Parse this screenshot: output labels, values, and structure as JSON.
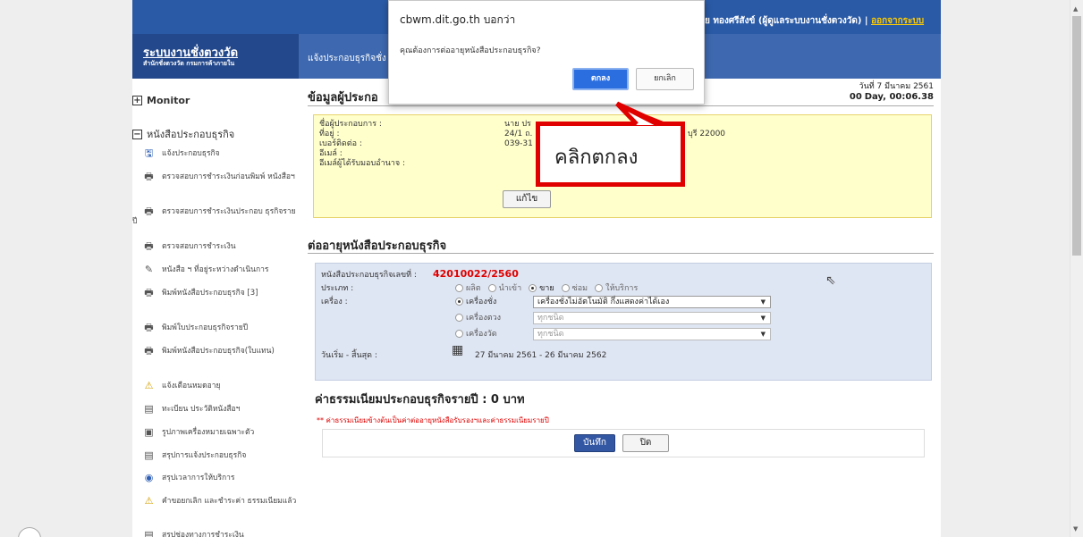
{
  "header": {
    "brand_title": "ระบบงานชั่งตวงวัด",
    "brand_sub": "สำนักชั่งตวงวัด กรมการค้าภายใน",
    "breadcrumb": "แจ้งประกอบธุรกิจชั่ง",
    "user": "ย ทองศรีสังข์ (ผู้ดูแลระบบงานชั่งตวงวัด) | ",
    "logout": "ออกจากระบบ"
  },
  "sidebar": {
    "monitor": "Monitor",
    "section": "หนังสือประกอบธุรกิจ",
    "items": [
      {
        "icon": "save-icon",
        "glyph": "🖫",
        "label": "แจ้งประกอบธุรกิจ"
      },
      {
        "icon": "printer-icon",
        "glyph": "🖶",
        "label": "ตรวจสอบการชำระเงินก่อนพิมพ์ หนังสือฯ"
      },
      {
        "icon": "printer-icon",
        "glyph": "🖶",
        "label": "ตรวจสอบการชำระเงินประกอบ ธุรกิจรายปี"
      },
      {
        "icon": "printer-icon",
        "glyph": "🖶",
        "label": "ตรวจสอบการชำระเงิน"
      },
      {
        "icon": "edit-icon",
        "glyph": "✎",
        "label": "หนังสือ ฯ ที่อยู่ระหว่างดำเนินการ"
      },
      {
        "icon": "printer-icon",
        "glyph": "🖶",
        "label": "พิมพ์หนังสือประกอบธุรกิจ [3]"
      },
      {
        "icon": "printer-icon",
        "glyph": "🖶",
        "label": "พิมพ์ใบประกอบธุรกิจรายปี"
      },
      {
        "icon": "printer-icon",
        "glyph": "🖶",
        "label": "พิมพ์หนังสือประกอบธุรกิจ(ใบแทน)"
      },
      {
        "icon": "warning-icon",
        "glyph": "⚠",
        "label": "แจ้งเตือนหมดอายุ"
      },
      {
        "icon": "register-icon",
        "glyph": "▤",
        "label": "ทะเบียน ประวัติหนังสือฯ"
      },
      {
        "icon": "image-icon",
        "glyph": "▣",
        "label": "รูปภาพเครื่องหมายเฉพาะตัว"
      },
      {
        "icon": "summary-icon",
        "glyph": "▤",
        "label": "สรุปการแจ้งประกอบธุรกิจ"
      },
      {
        "icon": "clock-icon",
        "glyph": "◉",
        "label": "สรุปเวลาการให้บริการ"
      },
      {
        "icon": "warning-icon",
        "glyph": "⚠",
        "label": "คำขอยกเลิก และชำระค่า ธรรมเนียมแล้ว"
      },
      {
        "icon": "summary-icon",
        "glyph": "▤",
        "label": "สรุปช่องทางการชำระเงิน"
      }
    ]
  },
  "main": {
    "section1_title": "ข้อมูลผู้ประกอ",
    "date_line": "วันที่ 7 มีนาคม 2561",
    "timer_strong": "00",
    "timer_rest": "Day, 00:06.38",
    "labels": [
      "ชื่อผู้ประกอบการ :",
      "ที่อยู่ :",
      "เบอร์ติดต่อ :",
      "อีเมล์ :",
      "อีเมล์ผู้ได้รับมอบอำนาจ :"
    ],
    "values": [
      "นาย ปร",
      "24/1 ถ.",
      "039-31"
    ],
    "address_tail": "บุรี 22000",
    "edit_button": "แก้ไข",
    "section2_title": "ต่ออายุหนังสือประกอบธุรกิจ",
    "license_label": "หนังสือประกอบธุรกิจเลขที่ :",
    "license_no": "42010022/2560",
    "type_label": "ประเภท :",
    "type_options": [
      "ผลิต",
      "นำเข้า",
      "ขาย",
      "ซ่อม",
      "ให้บริการ"
    ],
    "type_selected": "ขาย",
    "device_label": "เครื่อง :",
    "devices": [
      {
        "name": "เครื่องชั่ง",
        "value": "เครื่องชั่งไม่อัตโนมัติ กึ่งแสดงค่าได้เอง"
      },
      {
        "name": "เครื่องตวง",
        "value": "ทุกชนิด"
      },
      {
        "name": "เครื่องวัด",
        "value": "ทุกชนิด"
      }
    ],
    "period_label": "วันเริ่ม - สิ้นสุด :",
    "period_value": "27 มีนาคม 2561 - 26 มีนาคม 2562",
    "fee_title": "ค่าธรรมเนียมประกอบธุรกิจรายปี : 0 บาท",
    "fee_note": "** ค่าธรรมเนียมข้างต้นเป็นค่าต่ออายุหนังสือรับรองฯและค่าธรรมเนียมรายปี",
    "save_button": "บันทึก",
    "close_button": "ปิด"
  },
  "dialog": {
    "title": "cbwm.dit.go.th บอกว่า",
    "message": "คุณต้องการต่ออายุหนังสือประกอบธุรกิจ?",
    "ok": "ตกลง",
    "cancel": "ยกเลิก"
  },
  "callout": {
    "text": "คลิกตกลง",
    "color": "#e00000"
  }
}
